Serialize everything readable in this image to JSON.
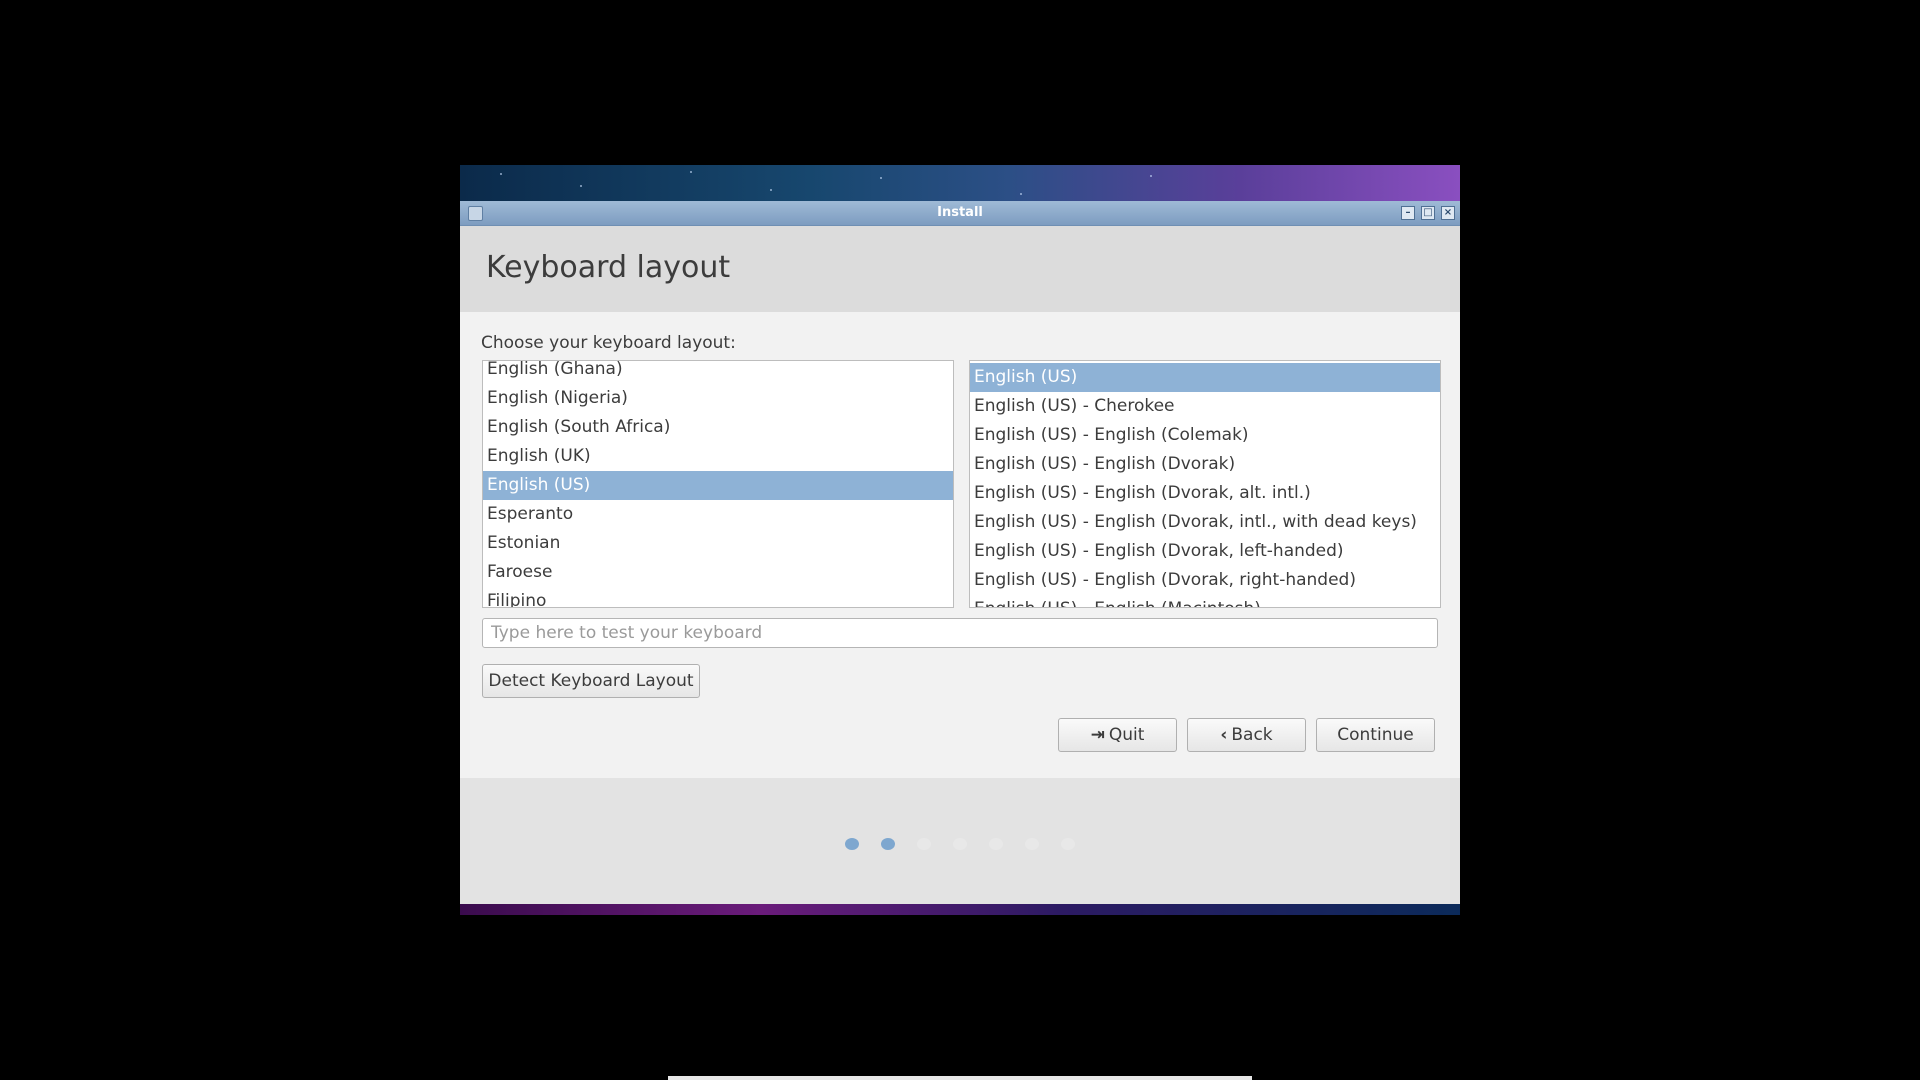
{
  "window": {
    "title": "Install",
    "buttons": {
      "minimize": "–",
      "maximize": "□",
      "close": "×"
    }
  },
  "page_title": "Keyboard layout",
  "prompt": "Choose your keyboard layout:",
  "layouts": {
    "items": [
      "English (Ghana)",
      "English (Nigeria)",
      "English (South Africa)",
      "English (UK)",
      "English (US)",
      "Esperanto",
      "Estonian",
      "Faroese",
      "Filipino"
    ],
    "selected": "English (US)"
  },
  "variants": {
    "items": [
      "English (US)",
      "English (US) - Cherokee",
      "English (US) - English (Colemak)",
      "English (US) - English (Dvorak)",
      "English (US) - English (Dvorak, alt. intl.)",
      "English (US) - English (Dvorak, intl., with dead keys)",
      "English (US) - English (Dvorak, left-handed)",
      "English (US) - English (Dvorak, right-handed)",
      "English (US) - English (Macintosh)"
    ],
    "selected": "English (US)"
  },
  "test_input": {
    "placeholder": "Type here to test your keyboard",
    "value": ""
  },
  "detect_button": "Detect Keyboard Layout",
  "nav": {
    "quit": "Quit",
    "back": "Back",
    "continue": "Continue"
  },
  "progress": {
    "total_steps": 7,
    "current_step": 2
  },
  "colors": {
    "selection": "#8eb2d6",
    "titlebar": "#8aa8cb",
    "progress_active": "#7ea7cf"
  }
}
